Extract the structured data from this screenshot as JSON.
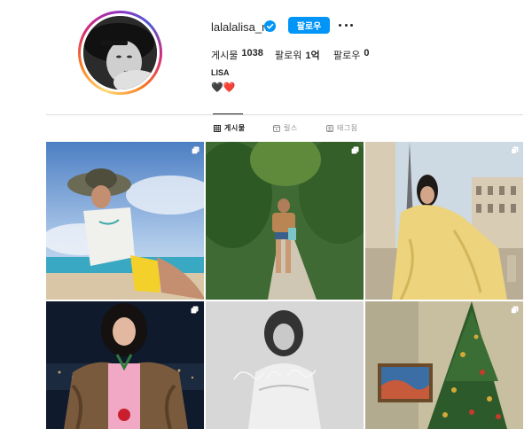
{
  "profile": {
    "username": "lalalalisa_m",
    "follow_label": "팔로우",
    "more_label": "옵션 더 보기",
    "full_name": "LISA",
    "bio": "🖤❤️"
  },
  "stats": {
    "posts_label": "게시물",
    "posts_count": "1038",
    "followers_label": "팔로워",
    "followers_count": "1억",
    "following_label": "팔로우",
    "following_count": "0"
  },
  "tabs": [
    {
      "label": "게시물",
      "icon": "grid-icon",
      "active": true
    },
    {
      "label": "릴스",
      "icon": "reels-icon",
      "active": false
    },
    {
      "label": "태그됨",
      "icon": "tagged-icon",
      "active": false
    }
  ],
  "posts": [
    {
      "icon": "multi-image-icon",
      "scene": "beach-bucket-hat"
    },
    {
      "icon": "multi-image-icon",
      "scene": "garden-path"
    },
    {
      "icon": "multi-image-icon",
      "scene": "paris-yellow-coat"
    },
    {
      "icon": "multi-image-icon",
      "scene": "night-fur-coat"
    },
    {
      "icon": "none",
      "scene": "album-cover-bw"
    },
    {
      "icon": "multi-image-icon",
      "scene": "christmas-tree"
    }
  ],
  "colors": {
    "accent": "#0095f6",
    "text": "#262626",
    "muted": "#8e8e8e",
    "divider": "#dbdbdb"
  }
}
